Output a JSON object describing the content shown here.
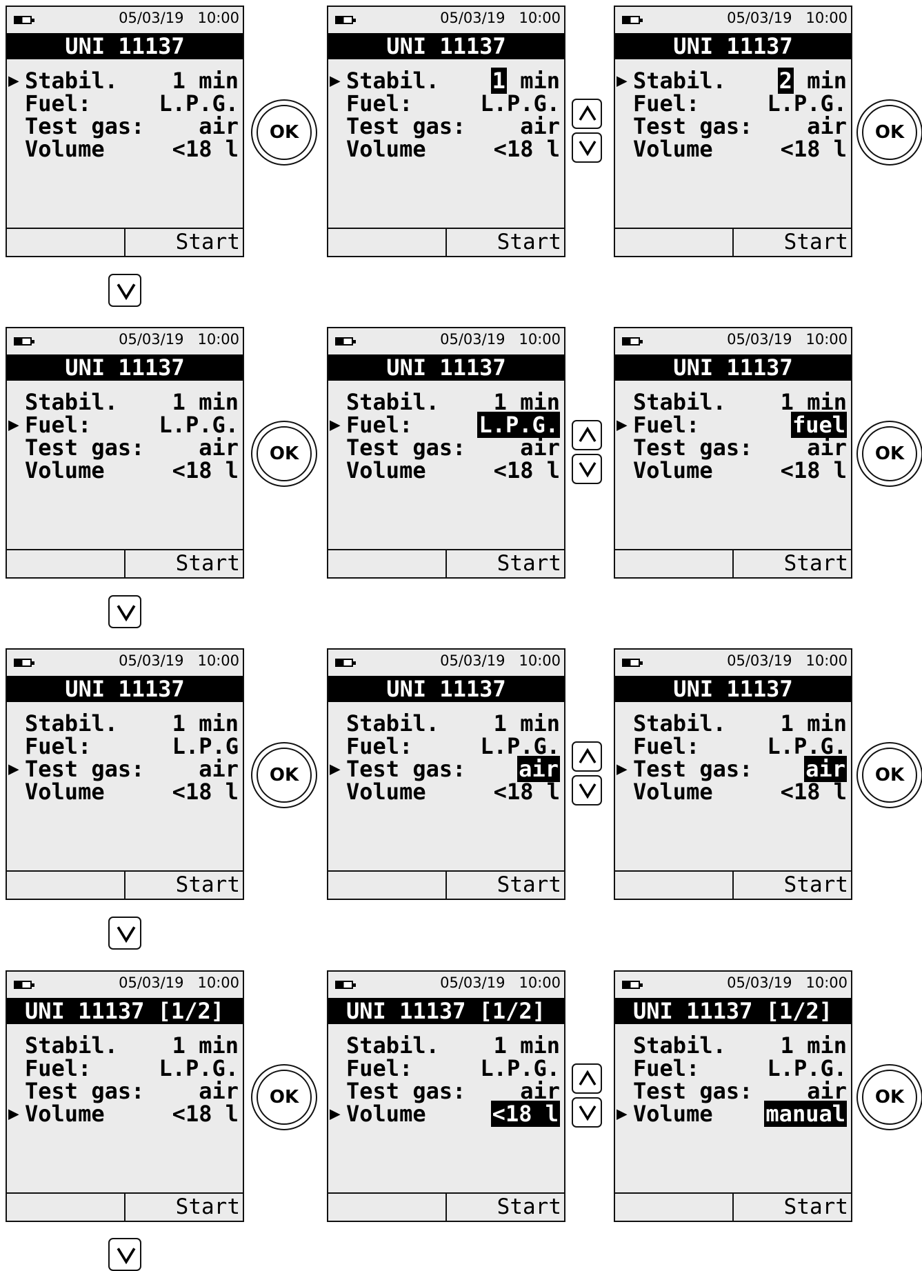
{
  "common": {
    "date": "05/03/19",
    "time": "10:00",
    "softkey_start": "Start",
    "ok_label": "OK",
    "labels": {
      "stabil": "Stabil.",
      "fuel": "Fuel:",
      "test_gas": "Test gas:",
      "volume": "Volume"
    },
    "icons": {
      "battery": "battery-half-icon",
      "selector": "selection-arrow-icon",
      "up": "up-arrow-key-icon",
      "down": "down-arrow-key-icon"
    }
  },
  "screens": [
    {
      "title": "UNI 11137",
      "stabil": "1 min",
      "fuel": "L.P.G.",
      "test_gas": "air",
      "volume": "<18 l",
      "selected": "stabil",
      "edit": null
    },
    {
      "title": "UNI 11137",
      "stabil": "1",
      "stabil_suffix": " min",
      "fuel": "L.P.G.",
      "test_gas": "air",
      "volume": "<18 l",
      "selected": "stabil",
      "edit": "stabil"
    },
    {
      "title": "UNI 11137",
      "stabil": "2",
      "stabil_suffix": " min",
      "fuel": "L.P.G.",
      "test_gas": "air",
      "volume": "<18 l",
      "selected": "stabil",
      "edit": "stabil"
    },
    {
      "title": "UNI 11137",
      "stabil": "1 min",
      "fuel": "L.P.G.",
      "test_gas": "air",
      "volume": "<18 l",
      "selected": "fuel",
      "edit": null
    },
    {
      "title": "UNI 11137",
      "stabil": "1 min",
      "fuel": "L.P.G.",
      "test_gas": "air",
      "volume": "<18 l",
      "selected": "fuel",
      "edit": "fuel"
    },
    {
      "title": "UNI 11137",
      "stabil": "1 min",
      "fuel": "fuel",
      "test_gas": "air",
      "volume": "<18 l",
      "selected": "fuel",
      "edit": "fuel"
    },
    {
      "title": "UNI 11137",
      "stabil": "1 min",
      "fuel": "L.P.G",
      "test_gas": "air",
      "volume": "<18 l",
      "selected": "test_gas",
      "edit": null
    },
    {
      "title": "UNI 11137",
      "stabil": "1 min",
      "fuel": "L.P.G.",
      "test_gas": "air",
      "volume": "<18 l",
      "selected": "test_gas",
      "edit": "test_gas"
    },
    {
      "title": "UNI 11137",
      "stabil": "1 min",
      "fuel": "L.P.G.",
      "test_gas": "air",
      "volume": "<18 l",
      "selected": "test_gas",
      "edit": "test_gas"
    },
    {
      "title": "UNI 11137 [1/2]",
      "stabil": "1 min",
      "fuel": "L.P.G.",
      "test_gas": "air",
      "volume": "<18 l",
      "selected": "volume",
      "edit": null
    },
    {
      "title": "UNI 11137 [1/2]",
      "stabil": "1 min",
      "fuel": "L.P.G.",
      "test_gas": "air",
      "volume": "<18 l",
      "selected": "volume",
      "edit": "volume"
    },
    {
      "title": "UNI 11137 [1/2]",
      "stabil": "1 min",
      "fuel": "L.P.G.",
      "test_gas": "air",
      "volume": "manual",
      "selected": "volume",
      "edit": "volume"
    }
  ]
}
